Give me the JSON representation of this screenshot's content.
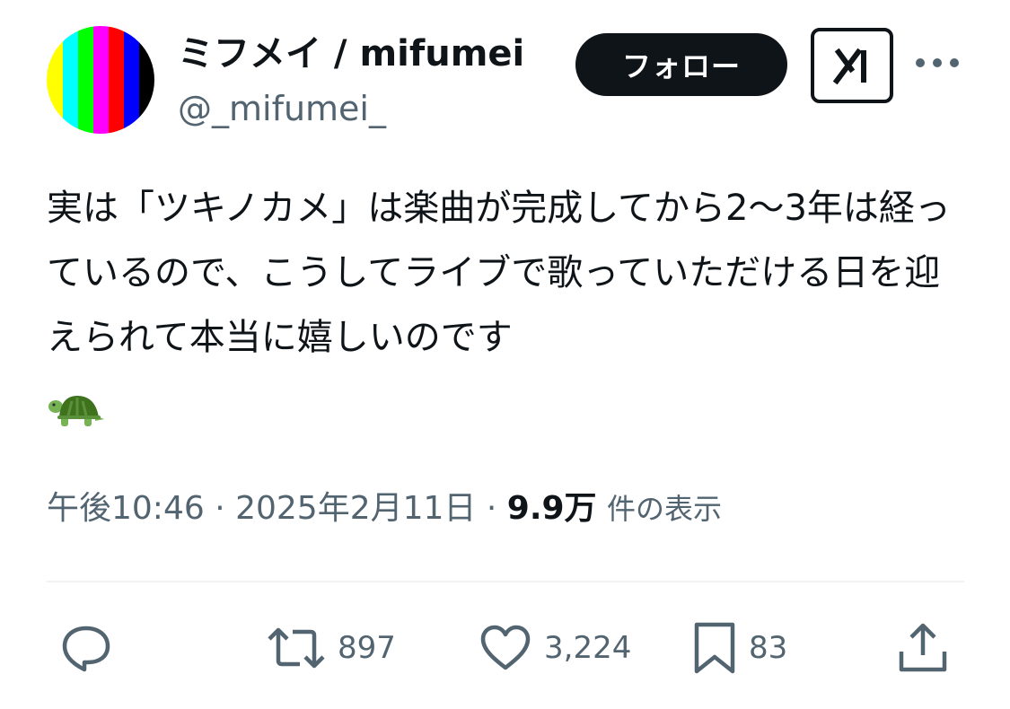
{
  "author": {
    "display_name": "ミフメイ / mifumei",
    "handle": "@_mifumei_",
    "avatar_colors": [
      "#ffff00",
      "#00ffff",
      "#00ff00",
      "#ff00ff",
      "#ff0000",
      "#0000ff",
      "#000000"
    ]
  },
  "header": {
    "follow_label": "フォロー",
    "grok_icon": "grok-icon",
    "more_icon": "more-dots-icon"
  },
  "tweet": {
    "text": "実は「ツキノカメ」は楽曲が完成してから2〜3年は経っているので、こうしてライブで歌っていただける日を迎えられて本当に嬉しいのです",
    "emoji": "turtle-emoji"
  },
  "meta": {
    "time": "午後10:46",
    "separator": " · ",
    "date": "2025年2月11日",
    "views_count": "9.9万",
    "views_label": "件の表示"
  },
  "actions": {
    "reply_icon": "reply-icon",
    "retweet_count": "897",
    "like_count": "3,224",
    "bookmark_count": "83",
    "share_icon": "share-icon"
  },
  "colors": {
    "text": "#0f1419",
    "secondary": "#536471",
    "divider": "#eff3f4",
    "follow_bg": "#0f1419"
  }
}
